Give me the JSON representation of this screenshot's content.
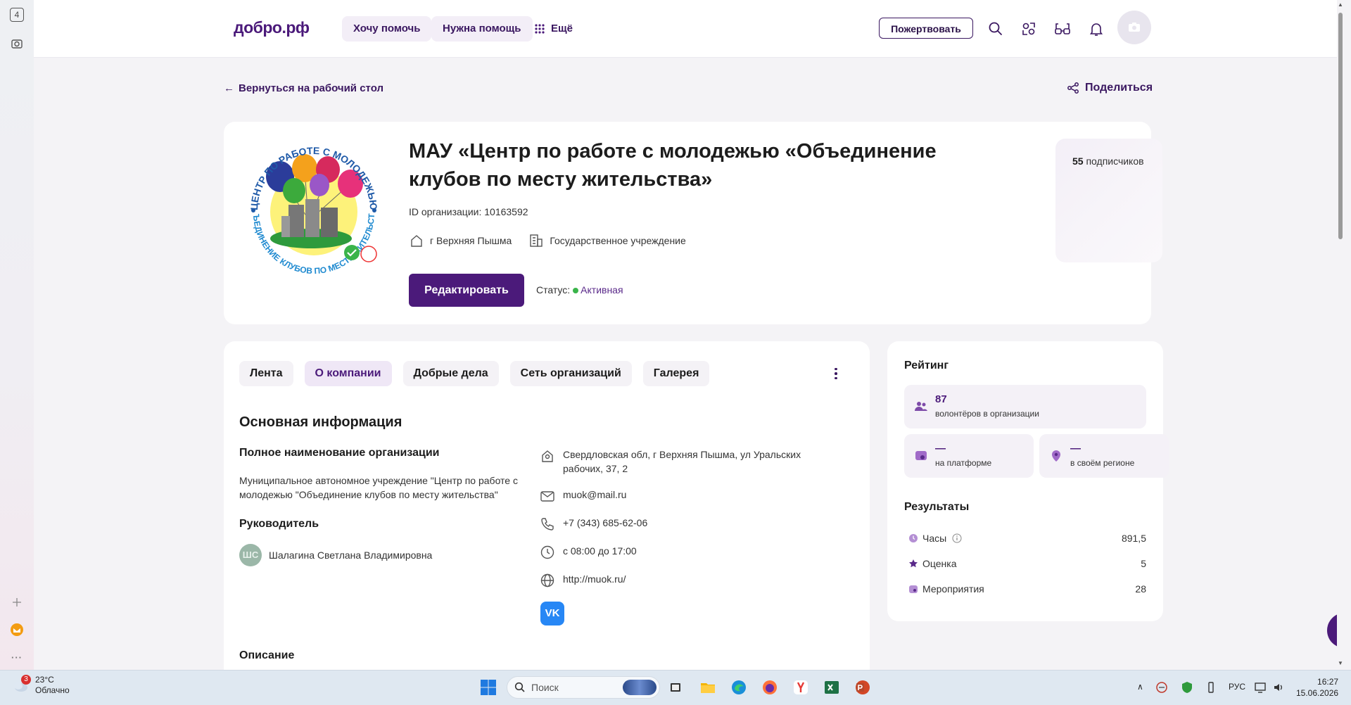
{
  "browser": {
    "tab_count": "4"
  },
  "header": {
    "logo": "добро.рф",
    "nav": [
      "Хочу помочь",
      "Нужна помощь"
    ],
    "more_label": "Ещё",
    "donate_label": "Пожертвовать"
  },
  "topnav": {
    "back_label": "Вернуться на рабочий стол",
    "share_label": "Поделиться"
  },
  "org": {
    "title": "МАУ «Центр по работе с молодежью «Объединение клубов по месту жительства»",
    "id_label": "ID организации: 10163592",
    "city": "г Верхняя Пышма",
    "type": "Государственное учреждение",
    "edit_label": "Редактировать",
    "status_label": "Статус:",
    "status_value": "Активная",
    "subscribers_count": "55",
    "subscribers_label": "подписчиков",
    "logo_ring_text": "ЦЕНТР ПО РАБОТЕ С МОЛОДЕЖЬЮ",
    "logo_ring_text_bottom": "ОБЪЕДИНЕНИЕ КЛУБОВ ПО МЕСТУ ЖИТЕЛЬСТВА"
  },
  "tabs": [
    {
      "label": "Лента",
      "active": false
    },
    {
      "label": "О компании",
      "active": true
    },
    {
      "label": "Добрые дела",
      "active": false
    },
    {
      "label": "Сеть организаций",
      "active": false
    },
    {
      "label": "Галерея",
      "active": false
    }
  ],
  "about": {
    "section_title": "Основная информация",
    "fullname_title": "Полное наименование организации",
    "fullname_value": "Муниципальное автономное учреждение \"Центр по работе с молодежью \"Объединение клубов по месту жительства\"",
    "leader_title": "Руководитель",
    "leader_initials": "ШС",
    "leader_name": "Шалагина Светлана Владимировна",
    "address": "Свердловская обл, г Верхняя Пышма, ул Уральских рабочих, 37, 2",
    "email": "muok@mail.ru",
    "phone": "+7 (343) 685-62-06",
    "hours": "с 08:00 до 17:00",
    "website": "http://muok.ru/",
    "social_label": "VK",
    "description_title": "Описание"
  },
  "rating": {
    "title": "Рейтинг",
    "volunteers_value": "87",
    "volunteers_label": "волонтёров в организации",
    "platform_value": "—",
    "platform_label": "на платформе",
    "region_value": "—",
    "region_label": "в своём регионе"
  },
  "results": {
    "title": "Результаты",
    "rows": [
      {
        "label": "Часы",
        "value": "891,5",
        "icon": "clock-icon"
      },
      {
        "label": "Оценка",
        "value": "5",
        "icon": "star-icon"
      },
      {
        "label": "Мероприятия",
        "value": "28",
        "icon": "event-icon"
      }
    ]
  },
  "taskbar": {
    "weather_badge": "3",
    "temperature": "23°C",
    "weather_text": "Облачно",
    "search_placeholder": "Поиск",
    "language": "РУС",
    "time": "16:27",
    "date": "15.06.2026"
  },
  "colors": {
    "brand": "#4b1a7a",
    "accent_bg": "#efe7f6",
    "status_green": "#3ab44a",
    "vk_blue": "#2787f5"
  }
}
